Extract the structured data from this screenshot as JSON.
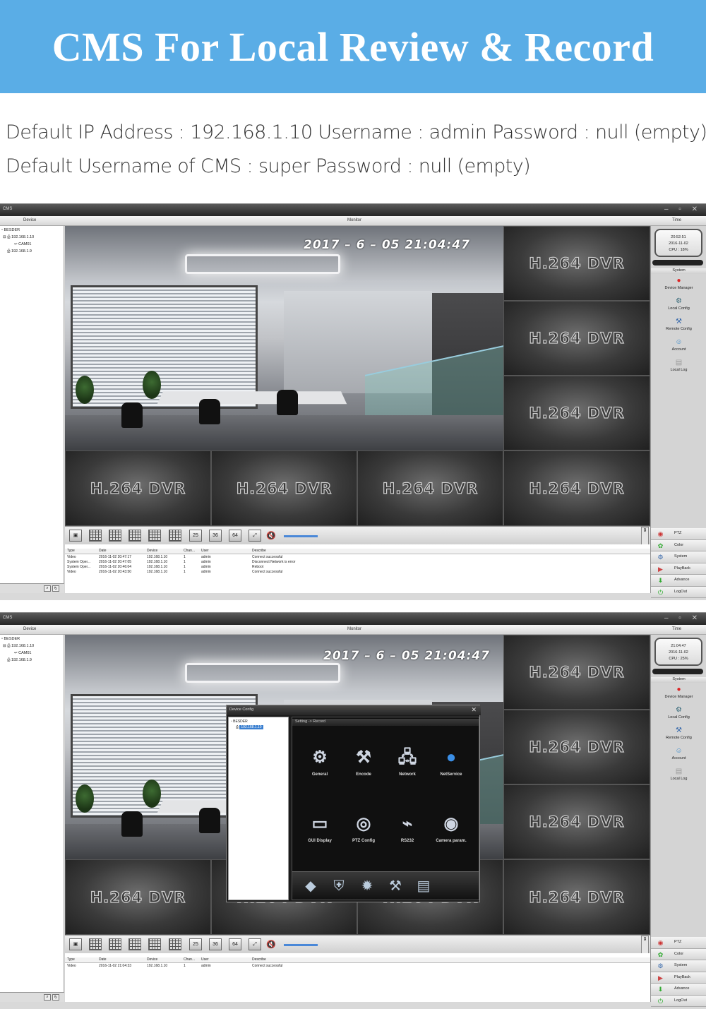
{
  "banner": {
    "title": "CMS For Local Review & Record"
  },
  "info": {
    "line1": "Default IP Address : 192.168.1.10  Username : admin Password : null (empty)",
    "line2": "Default Username of CMS : super Password : null (empty)"
  },
  "cms_common": {
    "window_title": "CMS",
    "window_buttons": "– ▫ ✕",
    "header_device": "Device",
    "header_monitor": "Monitor",
    "header_time": "Time",
    "tree": {
      "root": "BESDER",
      "device": "192.168.1.10",
      "cam": "CAM01",
      "device2": "192.168.1.9"
    },
    "timestamp": "2017 – 6 – 05  21:04:47",
    "tile_label": "H.264 DVR",
    "toolbar": {
      "btn_25": "25",
      "btn_36": "36",
      "btn_64": "64"
    },
    "log_headers": {
      "type": "Type",
      "date": "Date",
      "device": "Device",
      "chan": "Chan...",
      "user": "User",
      "describe": "Describe"
    },
    "system": {
      "header": "System",
      "items": [
        "Device Manager",
        "Local Config",
        "Remote Config",
        "Account",
        "Local Log"
      ]
    },
    "bottom_menu": [
      "PTZ",
      "Color",
      "System",
      "PlayBack",
      "Advance",
      "LogOut"
    ]
  },
  "screen1": {
    "clock": {
      "time": "20:52:51",
      "date": "2016-11-02",
      "cpu": "CPU : 18%"
    },
    "logs": [
      {
        "type": "Video",
        "date": "2016-11-02 20:47:17",
        "device": "192.168.1.10",
        "chan": "1",
        "user": "admin",
        "describe": "Connect successful"
      },
      {
        "type": "System Oper...",
        "date": "2016-11-02 20:47:05",
        "device": "192.168.1.10",
        "chan": "1",
        "user": "admin",
        "describe": "Disconnect Network is error"
      },
      {
        "type": "System Oper...",
        "date": "2016-11-02 20:46:04",
        "device": "192.168.1.10",
        "chan": "1",
        "user": "admin",
        "describe": "Reboot"
      },
      {
        "type": "Video",
        "date": "2016-11-02 20:43:50",
        "device": "192.168.1.10",
        "chan": "1",
        "user": "admin",
        "describe": "Connect successful"
      }
    ]
  },
  "screen2": {
    "clock": {
      "time": "21:04:47",
      "date": "2016-11-02",
      "cpu": "CPU : 25%"
    },
    "logs": [
      {
        "type": "Video",
        "date": "2016-11-02 21:04:33",
        "device": "192.168.1.10",
        "chan": "1",
        "user": "admin",
        "describe": "Connect successful"
      }
    ],
    "dialog": {
      "title": "Device Config",
      "close": "✕",
      "tree_root": "BESDER",
      "tree_device": "192.168.1.10",
      "breadcrumb": "Setting -> Record",
      "items": [
        "General",
        "Encode",
        "Network",
        "NetService",
        "GUI Display",
        "PTZ Config",
        "RS232",
        "Camera param."
      ]
    }
  }
}
